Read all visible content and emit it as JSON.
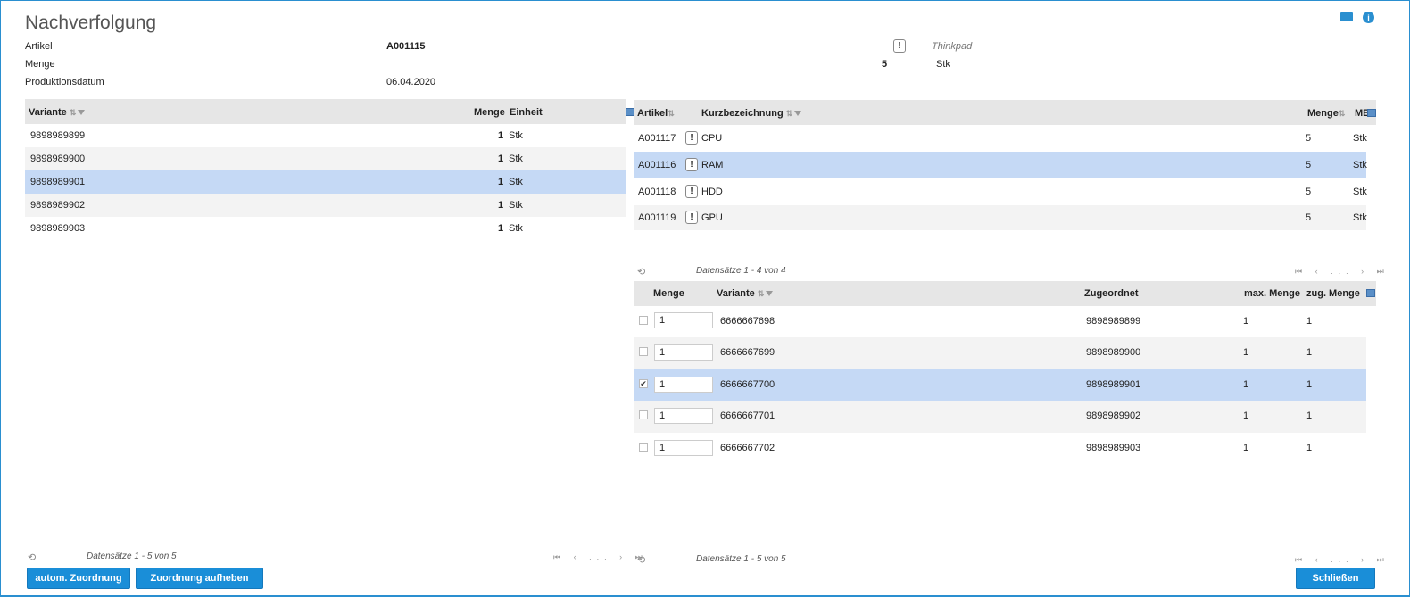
{
  "header": {
    "title": "Nachverfolgung",
    "artikel_label": "Artikel",
    "artikel_value": "A001115",
    "artikel_desc": "Thinkpad",
    "menge_label": "Menge",
    "menge_value": "5",
    "menge_unit": "Stk",
    "datum_label": "Produktionsdatum",
    "datum_value": "06.04.2020",
    "excl": "!"
  },
  "left_table": {
    "headers": {
      "variante": "Variante",
      "menge": "Menge",
      "einheit": "Einheit"
    },
    "rows": [
      {
        "variante": "9898989899",
        "menge": "1",
        "einheit": "Stk"
      },
      {
        "variante": "9898989900",
        "menge": "1",
        "einheit": "Stk"
      },
      {
        "variante": "9898989901",
        "menge": "1",
        "einheit": "Stk"
      },
      {
        "variante": "9898989902",
        "menge": "1",
        "einheit": "Stk"
      },
      {
        "variante": "9898989903",
        "menge": "1",
        "einheit": "Stk"
      }
    ],
    "count": "Datensätze 1 - 5 von 5"
  },
  "right_top_table": {
    "headers": {
      "artikel": "Artikel",
      "kurz": "Kurzbezeichnung",
      "menge": "Menge",
      "me": "ME"
    },
    "rows": [
      {
        "artikel": "A001117",
        "kurz": "CPU",
        "menge": "5",
        "me": "Stk"
      },
      {
        "artikel": "A001116",
        "kurz": "RAM",
        "menge": "5",
        "me": "Stk"
      },
      {
        "artikel": "A001118",
        "kurz": "HDD",
        "menge": "5",
        "me": "Stk"
      },
      {
        "artikel": "A001119",
        "kurz": "GPU",
        "menge": "5",
        "me": "Stk"
      }
    ],
    "count": "Datensätze 1 - 4 von 4"
  },
  "right_bottom_table": {
    "headers": {
      "menge": "Menge",
      "variante": "Variante",
      "zugeordnet": "Zugeordnet",
      "max": "max. Menge",
      "zug": "zug. Menge"
    },
    "rows": [
      {
        "checked": "",
        "menge": "1",
        "variante": "6666667698",
        "zugeordnet": "9898989899",
        "max": "1",
        "zug": "1"
      },
      {
        "checked": "",
        "menge": "1",
        "variante": "6666667699",
        "zugeordnet": "9898989900",
        "max": "1",
        "zug": "1"
      },
      {
        "checked": "✔",
        "menge": "1",
        "variante": "6666667700",
        "zugeordnet": "9898989901",
        "max": "1",
        "zug": "1"
      },
      {
        "checked": "",
        "menge": "1",
        "variante": "6666667701",
        "zugeordnet": "9898989902",
        "max": "1",
        "zug": "1"
      },
      {
        "checked": "",
        "menge": "1",
        "variante": "6666667702",
        "zugeordnet": "9898989903",
        "max": "1",
        "zug": "1"
      }
    ],
    "count": "Datensätze 1 - 5 von 5"
  },
  "pager": "⏮ ‹ ... › ⏭",
  "refresh": "⟲",
  "buttons": {
    "auto": "autom. Zuordnung",
    "aufheben": "Zuordnung aufheben",
    "close": "Schließen"
  },
  "icons": {
    "mail": "mail-icon",
    "info": "info-icon"
  },
  "colors": {
    "accent": "#1a8ed8",
    "selected_row": "#c5d9f5",
    "header_bg": "#e6e6e6"
  }
}
